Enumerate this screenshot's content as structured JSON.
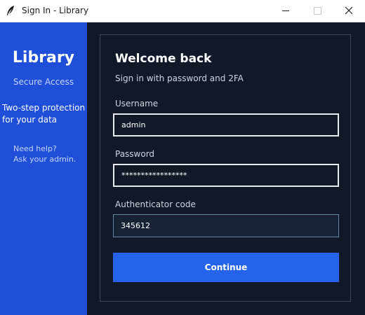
{
  "window": {
    "title": "Sign In - Library"
  },
  "sidebar": {
    "brand": "Library",
    "subtitle": "Secure Access",
    "feature_line1": "Two-step protection",
    "feature_line2": "for your data",
    "help_line1": "Need help?",
    "help_line2": "Ask your admin."
  },
  "form": {
    "heading": "Welcome back",
    "subheading": "Sign in with password and 2FA",
    "username": {
      "label": "Username",
      "value": "admin"
    },
    "password": {
      "label": "Password",
      "value": "*****************"
    },
    "otp": {
      "label": "Authenticator code",
      "value": "345612"
    },
    "submit_label": "Continue"
  },
  "colors": {
    "sidebar_bg": "#1f4fd8",
    "main_bg": "#111827",
    "accent": "#2563eb"
  }
}
